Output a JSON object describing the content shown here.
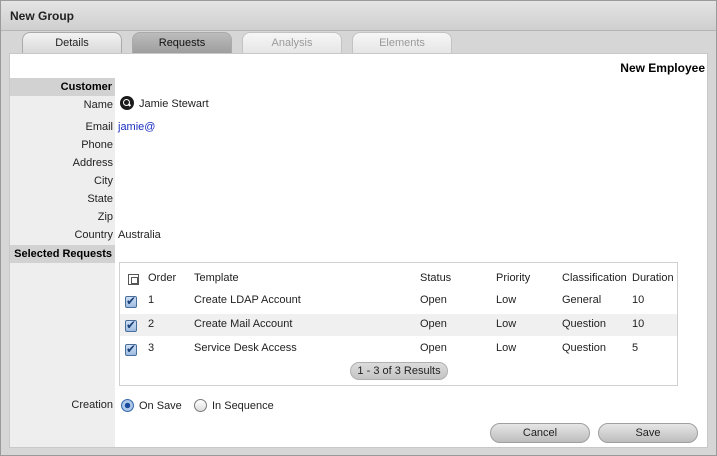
{
  "window": {
    "title": "New Group"
  },
  "tabs": [
    {
      "label": "Details",
      "state": "normal"
    },
    {
      "label": "Requests",
      "state": "active"
    },
    {
      "label": "Analysis",
      "state": "disabled"
    },
    {
      "label": "Elements",
      "state": "disabled"
    }
  ],
  "form_type": "New Employee",
  "customer": {
    "section_label": "Customer",
    "fields": [
      {
        "label": "Name",
        "value": "Jamie Stewart"
      },
      {
        "label": "Email",
        "value": "jamie@"
      },
      {
        "label": "Phone",
        "value": ""
      },
      {
        "label": "Address",
        "value": ""
      },
      {
        "label": "City",
        "value": ""
      },
      {
        "label": "State",
        "value": ""
      },
      {
        "label": "Zip",
        "value": ""
      },
      {
        "label": "Country",
        "value": "Australia"
      }
    ],
    "name_search_icon": "search-icon"
  },
  "requests": {
    "section_label": "Selected Requests",
    "columns": [
      "Order",
      "Template",
      "Status",
      "Priority",
      "Classification",
      "Duration"
    ],
    "rows": [
      {
        "checked": true,
        "order": "1",
        "template": "Create LDAP Account",
        "status": "Open",
        "priority": "Low",
        "classification": "General",
        "duration": "10"
      },
      {
        "checked": true,
        "order": "2",
        "template": "Create Mail Account",
        "status": "Open",
        "priority": "Low",
        "classification": "Question",
        "duration": "10"
      },
      {
        "checked": true,
        "order": "3",
        "template": "Service Desk Access",
        "status": "Open",
        "priority": "Low",
        "classification": "Question",
        "duration": "5"
      }
    ],
    "pager": "1 - 3 of 3 Results"
  },
  "creation": {
    "label": "Creation",
    "options": [
      {
        "label": "On Save",
        "selected": true
      },
      {
        "label": "In Sequence",
        "selected": false
      }
    ]
  },
  "buttons": {
    "cancel": "Cancel",
    "save": "Save"
  }
}
